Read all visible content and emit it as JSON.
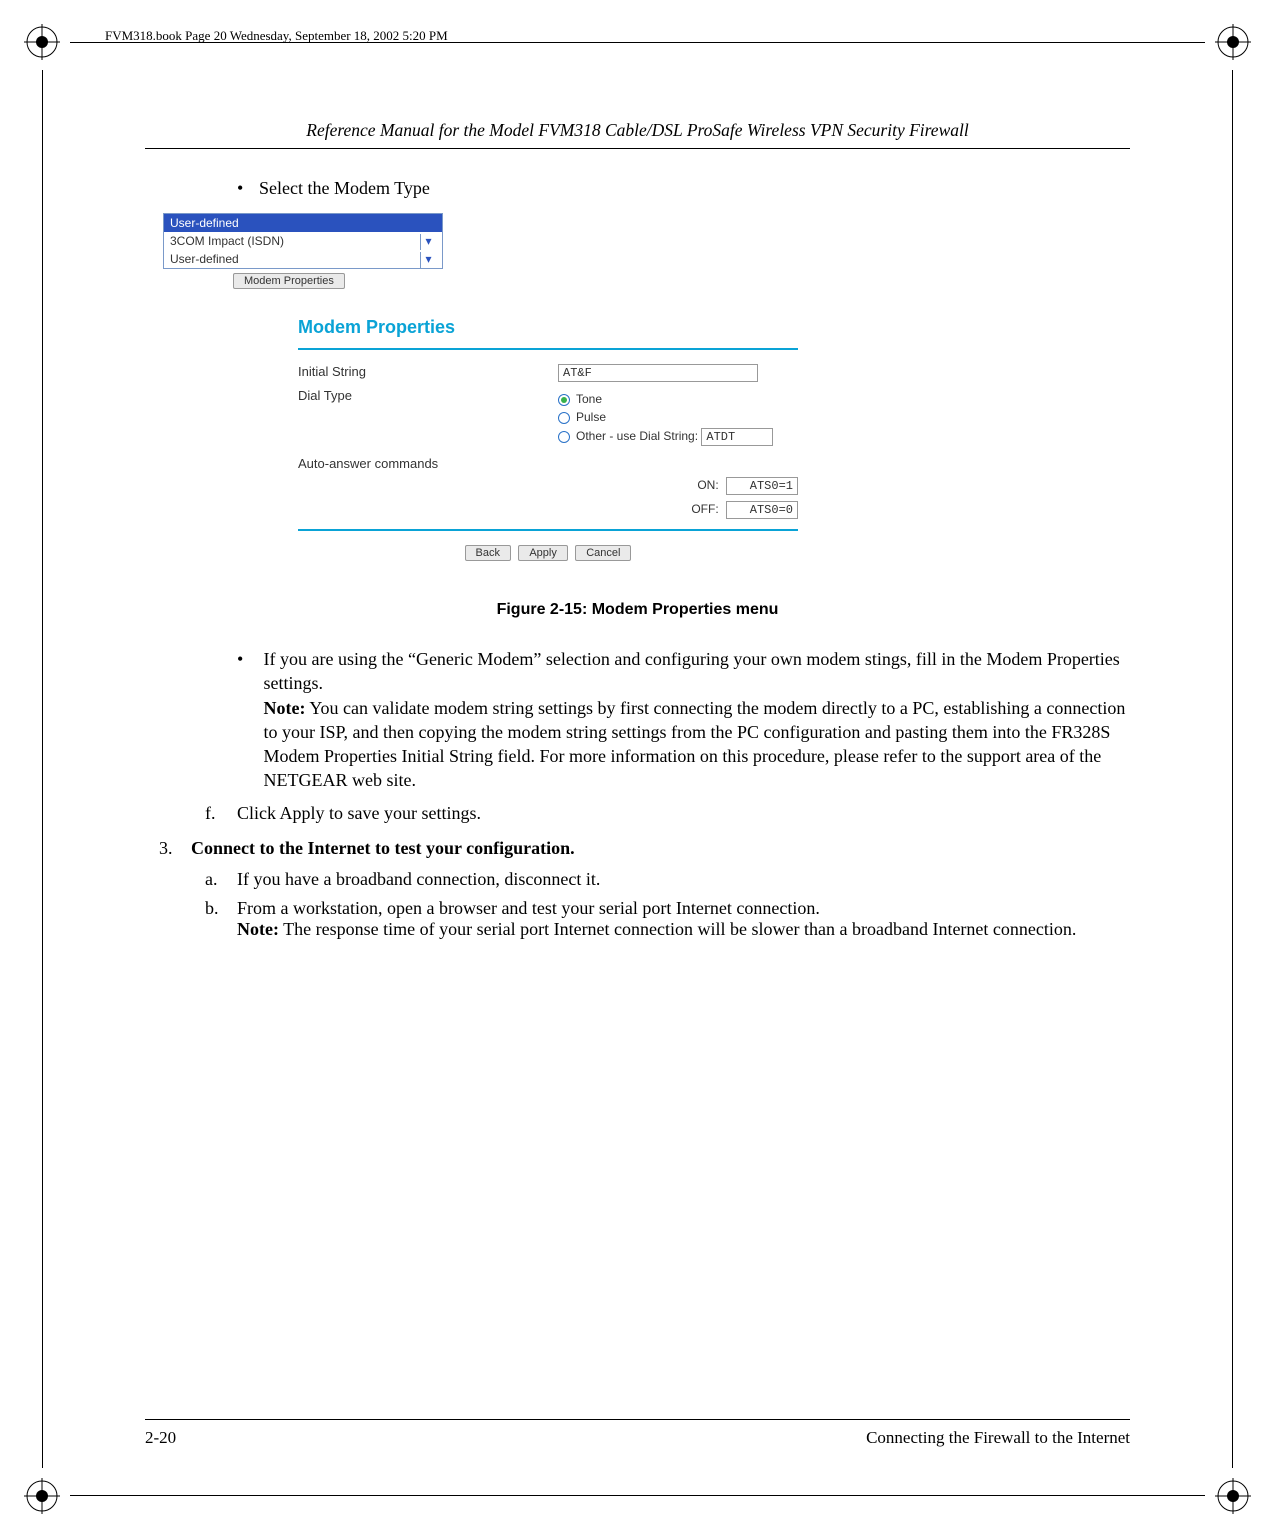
{
  "bookline": "FVM318.book  Page 20  Wednesday, September 18, 2002  5:20 PM",
  "header": {
    "title": "Reference Manual for the Model FVM318 Cable/DSL ProSafe Wireless VPN Security Firewall"
  },
  "bullet_select_modem": "Select the Modem Type",
  "dropdown": {
    "selected": "User-defined",
    "option_isdn": "3COM Impact (ISDN)",
    "option_user": "User-defined"
  },
  "btn_modem_props": "Modem Properties",
  "panel_title": "Modem Properties",
  "form": {
    "initial_string_label": "Initial String",
    "initial_string_value": "AT&F",
    "dial_type_label": "Dial Type",
    "radio_tone": "Tone",
    "radio_pulse": "Pulse",
    "radio_other_label": "Other - use Dial String:",
    "radio_other_value": "ATDT",
    "auto_answer_label": "Auto-answer commands",
    "on_label": "ON:",
    "on_value": "ATS0=1",
    "off_label": "OFF:",
    "off_value": "ATS0=0"
  },
  "buttons": {
    "back": "Back",
    "apply": "Apply",
    "cancel": "Cancel"
  },
  "figure_caption": "Figure 2-15: Modem Properties menu",
  "para_generic_1": "If you are using the “Generic Modem” selection and configuring your own modem stings, fill in the Modem Properties settings.",
  "note_label": "Note:",
  "para_generic_note": " You can validate modem string settings by first connecting the modem directly to a PC, establishing a connection to your ISP, and then copying the modem string settings from the PC configuration and pasting them into the FR328S Modem Properties Initial String field. For more information on this procedure, please refer to the support area of the NETGEAR web site.",
  "step_f_label": "f.",
  "step_f_text": "Click Apply to save your settings.",
  "step_3_label": "3.",
  "step_3_text": "Connect to the Internet to test your configuration.",
  "step_3a_label": "a.",
  "step_3a_text": "If you have a broadband connection, disconnect it.",
  "step_3b_label": "b.",
  "step_3b_text_1": "From a workstation, open a browser and test your serial port Internet connection.",
  "step_3b_note": " The response time of your serial port Internet connection will be slower than a broadband Internet connection.",
  "footer": {
    "page_num": "2-20",
    "section": "Connecting the Firewall to the Internet"
  }
}
